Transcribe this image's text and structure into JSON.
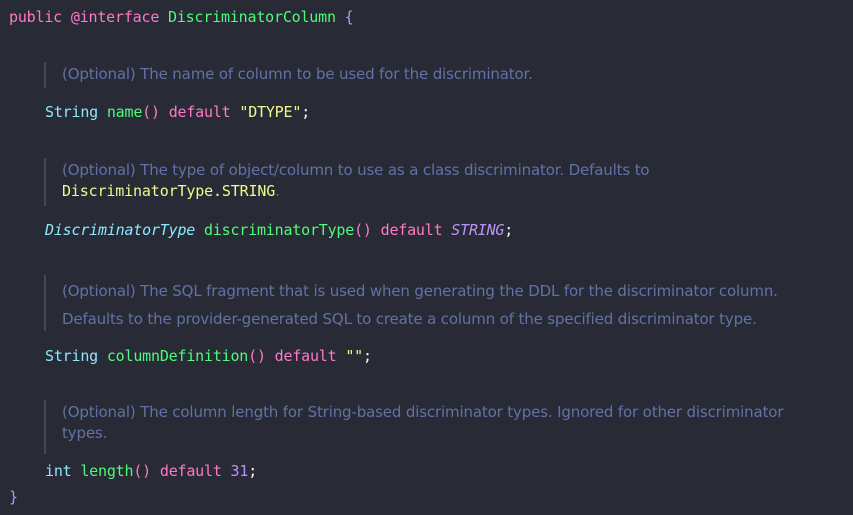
{
  "header": {
    "public": "public",
    "at": "@",
    "interface": "interface",
    "name": "DiscriminatorColumn",
    "open_brace": "{"
  },
  "members": [
    {
      "doc": [
        "(Optional) The name of column to be used for the discriminator."
      ],
      "type": "String",
      "method": "name",
      "parens": "()",
      "default_kw": "default",
      "value": "\"DTYPE\"",
      "semi": ";"
    },
    {
      "doc": [
        "(Optional) The type of object/column to use as a class discriminator. Defaults to"
      ],
      "doc_code": "DiscriminatorType.STRING",
      "doc_tail": ".",
      "type": "DiscriminatorType",
      "method": "discriminatorType",
      "parens": "()",
      "default_kw": "default",
      "value": "STRING",
      "semi": ";"
    },
    {
      "doc": [
        "(Optional) The SQL fragment that is used when generating the DDL for the discriminator column.",
        "Defaults to the provider-generated SQL to create a column of the specified discriminator type."
      ],
      "type": "String",
      "method": "columnDefinition",
      "parens": "()",
      "default_kw": "default",
      "value": "\"\"",
      "semi": ";"
    },
    {
      "doc": [
        "(Optional) The column length for String-based discriminator types. Ignored for other discriminator",
        "types."
      ],
      "type": "int",
      "method": "length",
      "parens": "()",
      "default_kw": "default",
      "value": "31",
      "semi": ";"
    }
  ],
  "footer": {
    "close_brace": "}"
  },
  "colors": {
    "background": "#282a36",
    "keyword": "#ff79c6",
    "type": "#8be9fd",
    "function": "#50fa7b",
    "string": "#f1fa8c",
    "number": "#bd93f9",
    "comment": "#6272a4"
  }
}
